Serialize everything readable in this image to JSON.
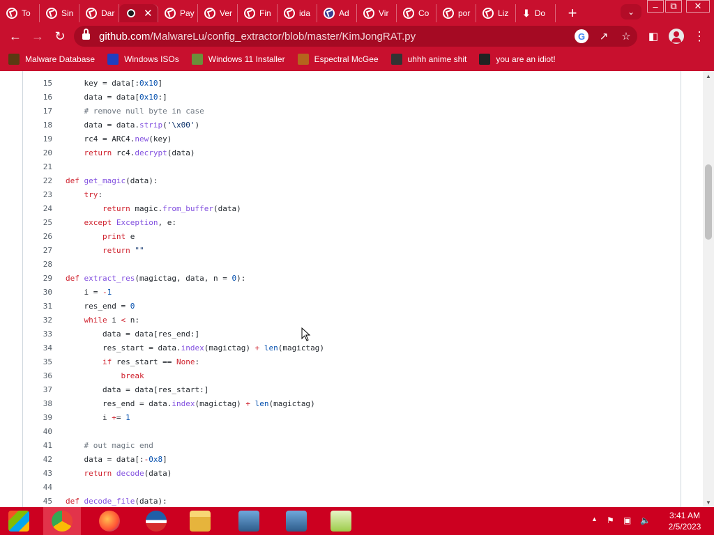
{
  "browser": {
    "tabs": [
      {
        "label": "To",
        "icon": "globe-icon"
      },
      {
        "label": "Sin",
        "icon": "globe-icon"
      },
      {
        "label": "Dar",
        "icon": "globe-icon"
      },
      {
        "label": "",
        "icon": "github-icon",
        "active": true,
        "close": "✕"
      },
      {
        "label": "Pay",
        "icon": "globe-icon"
      },
      {
        "label": "Ver",
        "icon": "globe-icon"
      },
      {
        "label": "Fin",
        "icon": "globe-icon"
      },
      {
        "label": "ida",
        "icon": "globe-icon"
      },
      {
        "label": "Ad",
        "icon": "spider-icon"
      },
      {
        "label": "Vir",
        "icon": "globe-icon"
      },
      {
        "label": "Co",
        "icon": "globe-icon"
      },
      {
        "label": "por",
        "icon": "globe-icon"
      },
      {
        "label": "Liz",
        "icon": "globe-icon"
      },
      {
        "label": "Do",
        "icon": "download-icon"
      }
    ],
    "new_tab_glyph": "+",
    "url_host": "github.com",
    "url_path": "/MalwareLu/config_extractor/blob/master/KimJongRAT.py",
    "bookmarks": [
      {
        "label": "Malware Database",
        "icon": "biohazard-icon",
        "color": "#5a3a12"
      },
      {
        "label": "Windows ISOs",
        "icon": "x-logo-icon",
        "color": "#1f3fbf"
      },
      {
        "label": "Windows 11 Installer",
        "icon": "image-icon",
        "color": "#6b8f3a"
      },
      {
        "label": "Espectral McGee",
        "icon": "face-icon",
        "color": "#b5651d"
      },
      {
        "label": "uhhh anime shit",
        "icon": "anime-face-icon",
        "color": "#333333"
      },
      {
        "label": "you are an idiot!",
        "icon": "smiley-icon",
        "color": "#222222"
      }
    ]
  },
  "code": {
    "lines": [
      {
        "n": "15",
        "text": "    key = data[:0x10]"
      },
      {
        "n": "16",
        "text": "    data = data[0x10:]"
      },
      {
        "n": "17",
        "text": "    # remove null byte in case"
      },
      {
        "n": "18",
        "text": "    data = data.strip('\\x00')"
      },
      {
        "n": "19",
        "text": "    rc4 = ARC4.new(key)"
      },
      {
        "n": "20",
        "text": "    return rc4.decrypt(data)"
      },
      {
        "n": "21",
        "text": ""
      },
      {
        "n": "22",
        "text": "def get_magic(data):"
      },
      {
        "n": "23",
        "text": "    try:"
      },
      {
        "n": "24",
        "text": "        return magic.from_buffer(data)"
      },
      {
        "n": "25",
        "text": "    except Exception, e:"
      },
      {
        "n": "26",
        "text": "        print e"
      },
      {
        "n": "27",
        "text": "        return \"\""
      },
      {
        "n": "28",
        "text": ""
      },
      {
        "n": "29",
        "text": "def extract_res(magictag, data, n = 0):"
      },
      {
        "n": "30",
        "text": "    i = -1"
      },
      {
        "n": "31",
        "text": "    res_end = 0"
      },
      {
        "n": "32",
        "text": "    while i < n:"
      },
      {
        "n": "33",
        "text": "        data = data[res_end:]"
      },
      {
        "n": "34",
        "text": "        res_start = data.index(magictag) + len(magictag)"
      },
      {
        "n": "35",
        "text": "        if res_start == None:"
      },
      {
        "n": "36",
        "text": "            break"
      },
      {
        "n": "37",
        "text": "        data = data[res_start:]"
      },
      {
        "n": "38",
        "text": "        res_end = data.index(magictag) + len(magictag)"
      },
      {
        "n": "39",
        "text": "        i += 1"
      },
      {
        "n": "40",
        "text": ""
      },
      {
        "n": "41",
        "text": "    # out magic end"
      },
      {
        "n": "42",
        "text": "    data = data[:-0x8]"
      },
      {
        "n": "43",
        "text": "    return decode(data)"
      },
      {
        "n": "44",
        "text": ""
      },
      {
        "n": "45",
        "text": "def decode_file(data):"
      }
    ]
  },
  "taskbar": {
    "apps": [
      {
        "name": "start-button",
        "icon": "windows-logo-icon"
      },
      {
        "name": "chrome",
        "icon": "chrome-icon",
        "active": true
      },
      {
        "name": "firefox",
        "icon": "firefox-icon"
      },
      {
        "name": "obama-logo",
        "icon": "obama-logo-icon"
      },
      {
        "name": "file-explorer",
        "icon": "folder-icon"
      },
      {
        "name": "network-tool-1",
        "icon": "network-computer-icon"
      },
      {
        "name": "network-tool-2",
        "icon": "network-computer-icon"
      },
      {
        "name": "task-manager",
        "icon": "chart-icon"
      }
    ],
    "time": "3:41 AM",
    "date": "2/5/2023"
  },
  "colors": {
    "theme": "#c8102e",
    "taskbar": "#cc0020"
  }
}
